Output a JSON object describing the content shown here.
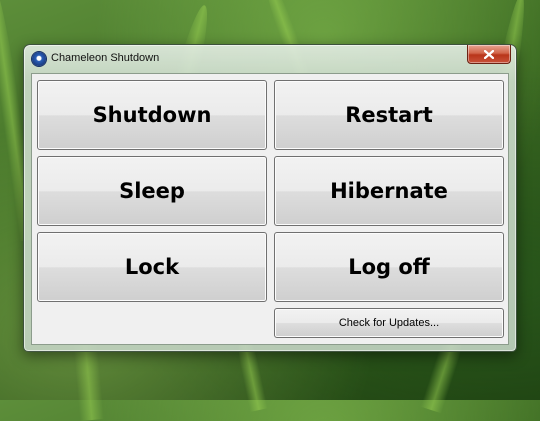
{
  "window": {
    "title": "Chameleon Shutdown",
    "icon": "chameleon-shutdown-icon"
  },
  "titlebar": {
    "close_icon": "close-icon",
    "close_color": "#c8452a"
  },
  "buttons": {
    "shutdown": "Shutdown",
    "restart": "Restart",
    "sleep": "Sleep",
    "hibernate": "Hibernate",
    "lock": "Lock",
    "log_off": "Log off",
    "check_updates": "Check for Updates..."
  },
  "desktop": {
    "wallpaper": "green grass"
  }
}
